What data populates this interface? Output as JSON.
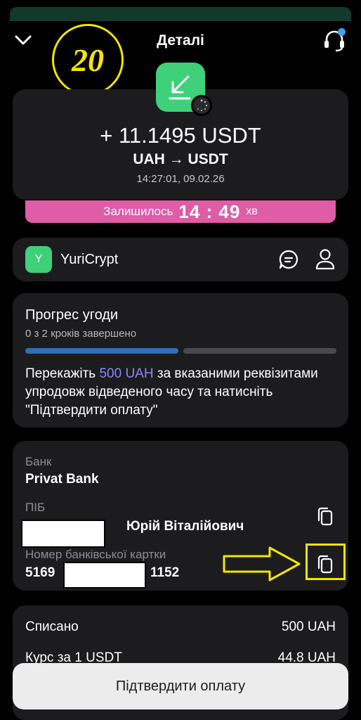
{
  "header": {
    "title": "Деталі"
  },
  "annotation": {
    "number": "20",
    "color": "#f2e600"
  },
  "transaction": {
    "amount": "+ 11.1495 USDT",
    "pair": "UAH → USDT",
    "datetime": "14:27:01, 09.02.26",
    "icon": "arrow-down-left-icon"
  },
  "timer": {
    "label": "Залишилось",
    "value": "14 : 49",
    "unit": "хв"
  },
  "merchant": {
    "avatar_letter": "Y",
    "name": "YuriCrypt"
  },
  "progress": {
    "title": "Прогрес угоди",
    "subtitle": "0 з 2 кроків завершено",
    "completed": 0,
    "total": 2,
    "instruction_pre": "Перекажіть ",
    "instruction_amount": "500 UAH",
    "instruction_post": " за вказаними реквізитами упродовж відведеного часу та натисніть \"Підтвердити оплату\""
  },
  "details": {
    "bank_label": "Банк",
    "bank_value": "Privat Bank",
    "name_label": "ПІБ",
    "name_value": "Юрій Віталійович",
    "card_label": "Номер банківської картки",
    "card_prefix": "5169",
    "card_suffix": "1152"
  },
  "fees": {
    "debited_label": "Списано",
    "debited_value": "500 UAH",
    "rate_label": "Курс за 1 USDT",
    "rate_value": "44.8 UAH"
  },
  "confirm_button": "Підтвердити оплату",
  "colors": {
    "accent_green": "#3fd07a",
    "timer_pink": "#df5ca7",
    "progress_blue": "#2f6fb7",
    "highlight_purple": "#8c86f5"
  }
}
